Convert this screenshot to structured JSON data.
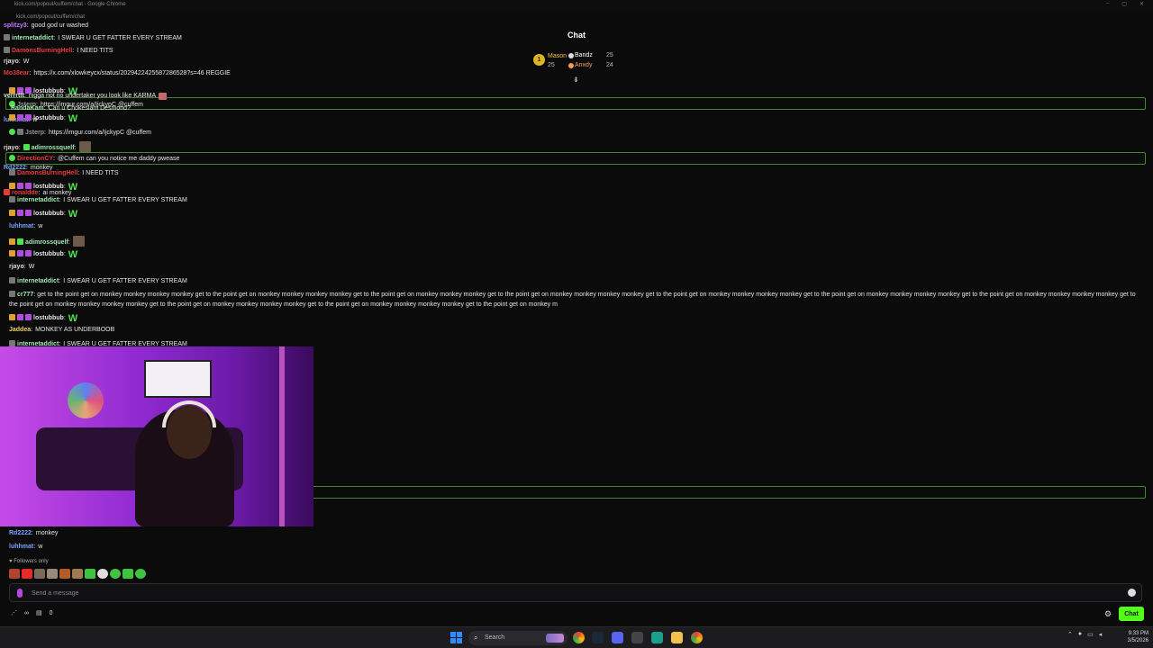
{
  "browser": {
    "title": "kick.com/popout/cuffem/chat - Google Chrome",
    "url": "kick.com/popout/cuffem/chat"
  },
  "chat": {
    "header": "Chat",
    "leaderboard": {
      "rank": "1",
      "first": {
        "name": "Mason",
        "points": "25"
      },
      "second": {
        "name": "Bandz",
        "points": "25"
      },
      "third": {
        "name": "Anxdy",
        "points": "24"
      }
    },
    "messages": [
      {
        "user": "splitzy3",
        "text": "good god ur washed",
        "user_color": "#c37bff"
      },
      {
        "user": "internetaddict",
        "text": "I SWEAR U GET FATTER EVERY STREAM",
        "user_color": "#9fe6b0"
      },
      {
        "user": "DamonsBurningHell",
        "text": "I NEED TITS",
        "user_color": "#e83a3a"
      },
      {
        "user": "rjayo",
        "text": "W",
        "user_color": "#dddddd"
      },
      {
        "user": "Mo38ear",
        "text": "https://x.com/xlowkeycx/status/2029422425587286528?s=46 REGGIE",
        "user_color": "#e83a3a"
      },
      {
        "user": "verrrttt",
        "text": "nigga not no undertaker you look like KARMA",
        "user_color": "#dddddd"
      },
      {
        "user": "RandaKam",
        "text": "Can u Chokeslam Desmond?",
        "user_color": "#dddddd"
      },
      {
        "user": "Rd2222",
        "text": "monkey",
        "user_color": "#7aa2ff"
      },
      {
        "user": "ronaldde",
        "text": "ai monkey",
        "user_color": "#e83a3a"
      }
    ],
    "overlay_messages": [
      {
        "user": "lostubbub",
        "text": "W",
        "user_color": "#dddddd"
      },
      {
        "user": "Jsterp",
        "text": "https://imgur.com/a/IjckypC @cuffem",
        "user_color": "#dddddd"
      },
      {
        "user": "luhhmat",
        "text": "w",
        "user_color": "#7aa2ff"
      },
      {
        "user": "lostubbub",
        "text": "W",
        "user_color": "#dddddd"
      },
      {
        "user": "Jsterp",
        "text": "https://imgur.com/a/IjckypC @cuffem",
        "user_color": "#dddddd"
      },
      {
        "user": "adimrossquelf",
        "text": "",
        "user_color": "#9fe6b0"
      },
      {
        "user": "DirectionCY",
        "text": "@Cuffem can you notice me daddy pwease",
        "user_color": "#e83a3a"
      },
      {
        "user": "DamonsBurningHell",
        "text": "I NEED TITS",
        "user_color": "#e83a3a"
      },
      {
        "user": "lostubbub",
        "text": "W",
        "user_color": "#dddddd"
      },
      {
        "user": "internetaddict",
        "text": "I SWEAR U GET FATTER EVERY STREAM",
        "user_color": "#9fe6b0"
      },
      {
        "user": "lostubbub",
        "text": "W",
        "user_color": "#dddddd"
      },
      {
        "user": "luhhmat",
        "text": "w",
        "user_color": "#7aa2ff"
      },
      {
        "user": "adimrossquelf",
        "text": "",
        "user_color": "#9fe6b0"
      },
      {
        "user": "lostubbub",
        "text": "W",
        "user_color": "#dddddd"
      },
      {
        "user": "rjayo",
        "text": "W",
        "user_color": "#dddddd"
      },
      {
        "user": "internetaddict",
        "text": "I SWEAR U GET FATTER EVERY STREAM",
        "user_color": "#9fe6b0"
      }
    ],
    "long_message": {
      "user": "cr777",
      "text": "get to the point get on monkey monkey monkey monkey get to the point get on monkey monkey monkey monkey get to the point get on monkey monkey monkey get to the point get on monkey monkey monkey monkey get to the point get on monkey monkey monkey monkey get to the point get on monkey monkey monkey monkey get to the point get on monkey monkey monkey monkey get to the point get on monkey monkey monkey monkey get to the point get on monkey monkey monkey monkey get to the point get on monkey monkey monkey monkey get to the point get on monkey m"
    },
    "after_messages": [
      {
        "user": "lostubbub",
        "text": "W",
        "user_color": "#dddddd"
      },
      {
        "user": "Jaddea",
        "text": "MONKEY AS UNDERBOOB",
        "user_color": "#f0d070"
      },
      {
        "user": "internetaddict",
        "text": "I SWEAR U GET FATTER EVERY STREAM",
        "user_color": "#9fe6b0"
      }
    ],
    "bottom_messages": [
      {
        "user": "Rd2222",
        "text": "monkey",
        "user_color": "#7aa2ff"
      },
      {
        "user": "luhhmat",
        "text": "w",
        "user_color": "#7aa2ff"
      }
    ],
    "followers_only": "Followers only",
    "input_placeholder": "Send a message",
    "infinity_label": "∞",
    "gift_count": "0",
    "chat_button": "Chat"
  },
  "taskbar": {
    "search_label": "Search",
    "time": "9:33 PM",
    "date": "3/5/2026"
  },
  "colors": {
    "kick_green": "#53fc18",
    "highlight_border": "#3c8a2a"
  }
}
